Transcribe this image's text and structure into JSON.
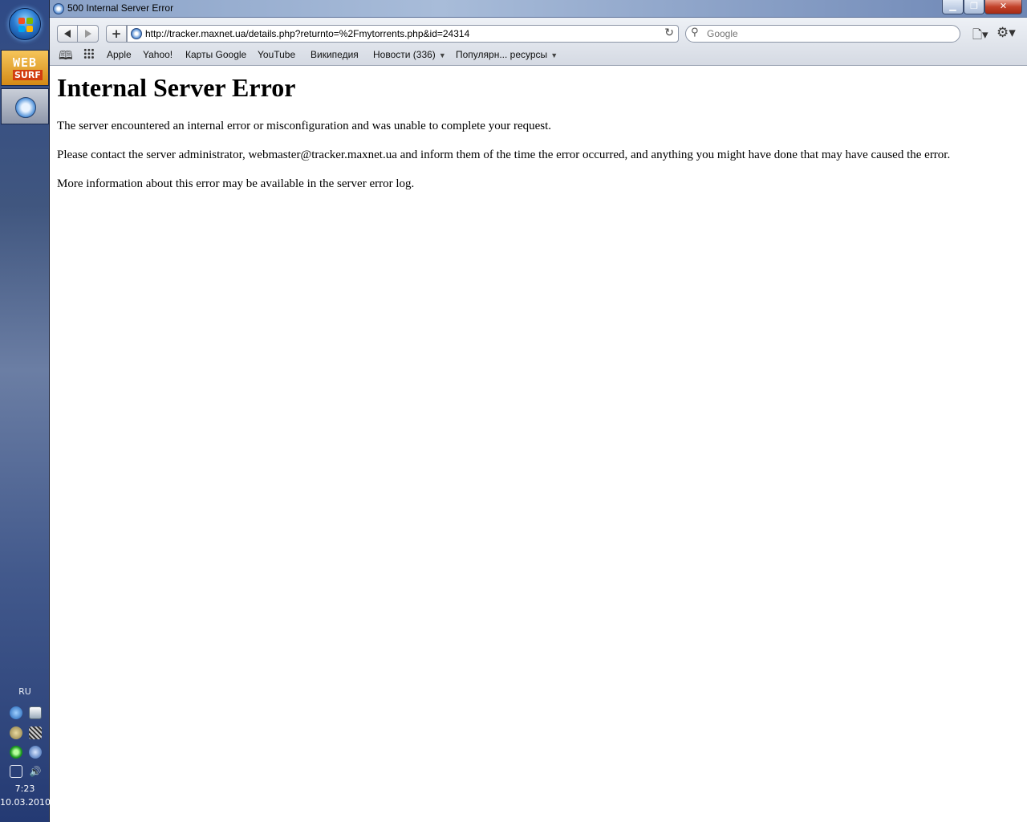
{
  "window": {
    "title": "500 Internal Server Error"
  },
  "toolbar": {
    "address": "http://tracker.maxnet.ua/details.php?returnto=%2Fmytorrents.php&id=24314",
    "search_placeholder": "Google"
  },
  "bookmarks": {
    "items": [
      {
        "label": "Apple"
      },
      {
        "label": "Yahoo!"
      },
      {
        "label": "Карты Google"
      },
      {
        "label": "YouTube"
      },
      {
        "label": "Википедия"
      },
      {
        "label": "Новости (336)"
      },
      {
        "label": "Популярн... ресурсы"
      }
    ]
  },
  "page": {
    "heading": "Internal Server Error",
    "paragraphs": [
      "The server encountered an internal error or misconfiguration and was unable to complete your request.",
      "Please contact the server administrator, webmaster@tracker.maxnet.ua and inform them of the time the error occurred, and anything you might have done that may have caused the error.",
      "More information about this error may be available in the server error log."
    ]
  },
  "taskbar": {
    "websurf_line1": "WEB",
    "websurf_line2": "SURF",
    "language": "RU",
    "clock_time": "7:23",
    "clock_date": "10.03.2010"
  }
}
